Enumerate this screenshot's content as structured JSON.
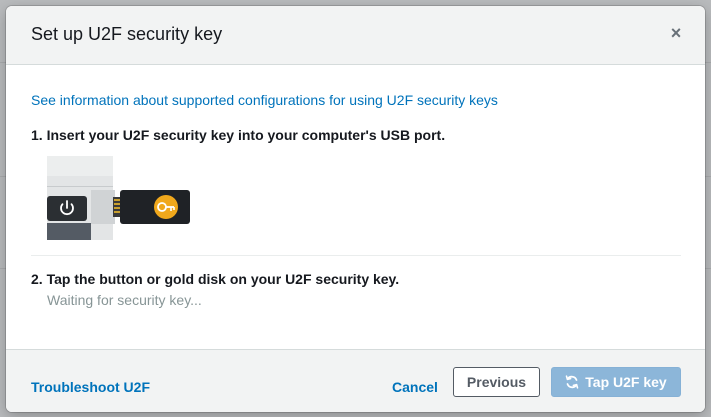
{
  "dialog": {
    "title": "Set up U2F security key",
    "close_symbol": "×",
    "info_link": "See information about supported configurations for using U2F security keys",
    "steps": [
      {
        "label": "1. Insert your U2F security key into your computer's USB port."
      },
      {
        "label": "2. Tap the button or gold disk on your U2F security key.",
        "status": "Waiting for security key..."
      }
    ],
    "illustration": {
      "icons": [
        "power-icon",
        "key-icon"
      ],
      "key_disk_color": "#f0a81c"
    }
  },
  "footer": {
    "troubleshoot": "Troubleshoot U2F",
    "cancel": "Cancel",
    "previous": "Previous",
    "tap_key": "Tap U2F key",
    "tap_key_icon": "refresh-icon"
  },
  "colors": {
    "link": "#0073bb",
    "primary_disabled": "#8cb6d9",
    "header_bg": "#f2f3f3",
    "text": "#16191f",
    "muted": "#879596"
  }
}
